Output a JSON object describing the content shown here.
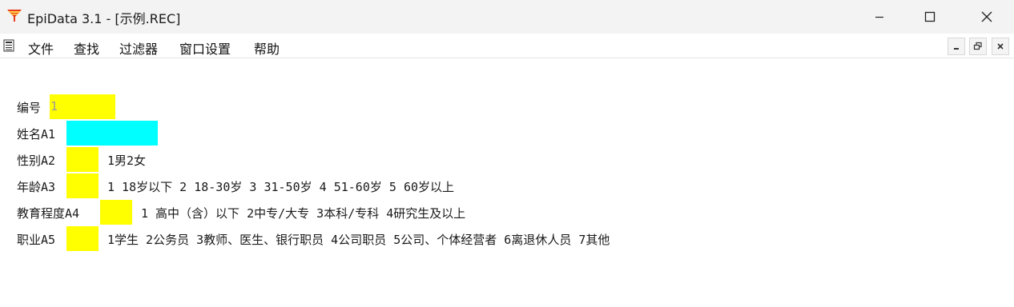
{
  "window": {
    "title": "EpiData 3.1 - [示例.REC]",
    "icon": "epidata-funnel-icon",
    "controls": [
      "minimize",
      "maximize",
      "close"
    ]
  },
  "menu": {
    "items": [
      "文件",
      "查找",
      "过滤器",
      "窗口设置",
      "帮助"
    ]
  },
  "colors": {
    "field_default": "#ffff00",
    "field_active": "#00ffff"
  },
  "form": {
    "fields": [
      {
        "label": "编号",
        "value": "1",
        "hint": ""
      },
      {
        "label": "姓名A1",
        "value": "",
        "hint": ""
      },
      {
        "label": "性别A2",
        "value": "",
        "hint": "1男2女"
      },
      {
        "label": "年龄A3",
        "value": "",
        "hint": "1 18岁以下 2 18-30岁 3 31-50岁 4 51-60岁 5 60岁以上"
      },
      {
        "label": "教育程度A4",
        "value": "",
        "hint": "1 高中（含）以下 2中专/大专 3本科/专科 4研究生及以上"
      },
      {
        "label": "职业A5",
        "value": "",
        "hint": "1学生 2公务员 3教师、医生、银行职员 4公司职员 5公司、个体经营者 6离退休人员 7其他"
      }
    ]
  }
}
